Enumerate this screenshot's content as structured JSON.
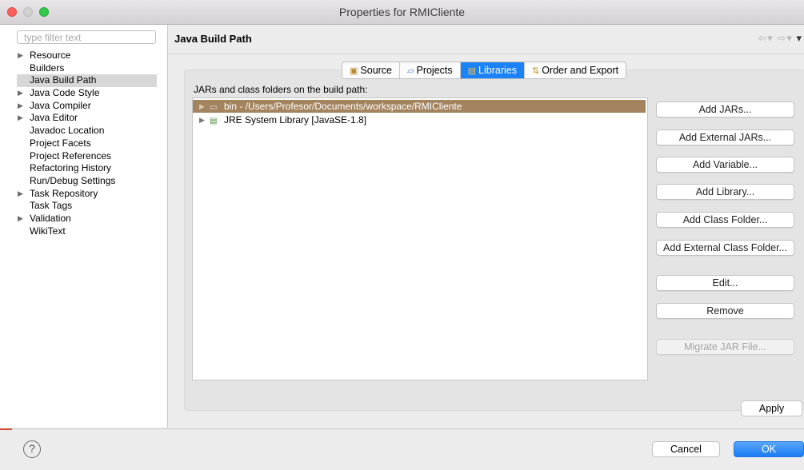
{
  "window": {
    "title": "Properties for RMICliente"
  },
  "sidebar": {
    "filter_placeholder": "type filter text",
    "items": [
      {
        "label": "Resource",
        "expandable": true
      },
      {
        "label": "Builders",
        "expandable": false
      },
      {
        "label": "Java Build Path",
        "expandable": false,
        "selected": true
      },
      {
        "label": "Java Code Style",
        "expandable": true
      },
      {
        "label": "Java Compiler",
        "expandable": true
      },
      {
        "label": "Java Editor",
        "expandable": true
      },
      {
        "label": "Javadoc Location",
        "expandable": false
      },
      {
        "label": "Project Facets",
        "expandable": false
      },
      {
        "label": "Project References",
        "expandable": false
      },
      {
        "label": "Refactoring History",
        "expandable": false
      },
      {
        "label": "Run/Debug Settings",
        "expandable": false
      },
      {
        "label": "Task Repository",
        "expandable": true
      },
      {
        "label": "Task Tags",
        "expandable": false
      },
      {
        "label": "Validation",
        "expandable": true
      },
      {
        "label": "WikiText",
        "expandable": false
      }
    ]
  },
  "page": {
    "title": "Java Build Path",
    "nav_icons": [
      "back-arrow-icon",
      "forward-arrow-icon",
      "menu-icon"
    ],
    "tabs": [
      {
        "label": "Source",
        "icon": "source-folder-icon"
      },
      {
        "label": "Projects",
        "icon": "folder-icon"
      },
      {
        "label": "Libraries",
        "icon": "library-icon",
        "active": true
      },
      {
        "label": "Order and Export",
        "icon": "order-icon"
      }
    ],
    "list_label": "JARs and class folders on the build path:",
    "entries": [
      {
        "text": "bin - /Users/Profesor/Documents/workspace/RMICliente",
        "icon": "class-folder-icon",
        "selected": true
      },
      {
        "text": "JRE System Library [JavaSE-1.8]",
        "icon": "library-icon",
        "selected": false
      }
    ],
    "buttons": [
      {
        "label": "Add JARs...",
        "enabled": true
      },
      {
        "label": "Add External JARs...",
        "enabled": true
      },
      {
        "label": "Add Variable...",
        "enabled": true
      },
      {
        "label": "Add Library...",
        "enabled": true
      },
      {
        "label": "Add Class Folder...",
        "enabled": true
      },
      {
        "label": "Add External Class Folder...",
        "enabled": true
      },
      {
        "label": "Edit...",
        "enabled": true
      },
      {
        "label": "Remove",
        "enabled": true
      },
      {
        "label": "Migrate JAR File...",
        "enabled": false
      }
    ],
    "apply_label": "Apply"
  },
  "footer": {
    "help_symbol": "?",
    "cancel_label": "Cancel",
    "ok_label": "OK"
  },
  "colors": {
    "accent": "#1c82f7",
    "selection_row": "#a4845f",
    "close": "#fc605c",
    "maximize": "#34c84a"
  }
}
